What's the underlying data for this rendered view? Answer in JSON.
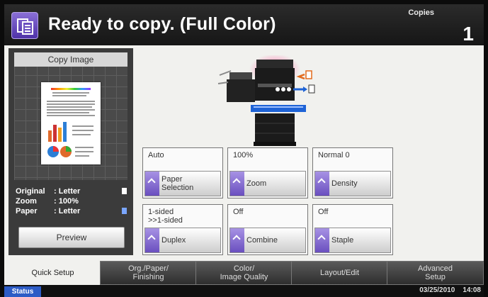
{
  "header": {
    "icon": "copy-icon",
    "title": "Ready to copy. (Full Color)",
    "copies_label": "Copies",
    "copies_value": "1"
  },
  "preview": {
    "title": "Copy Image",
    "original_label": "Original",
    "original_value": ": Letter",
    "zoom_label": "Zoom",
    "zoom_value": ": 100%",
    "paper_label": "Paper",
    "paper_value": ": Letter",
    "preview_button": "Preview"
  },
  "functions": [
    {
      "value": "Auto",
      "label": "Paper\nSelection",
      "icon": "chevron-up-icon"
    },
    {
      "value": "100%",
      "label": "Zoom",
      "icon": "chevron-up-icon"
    },
    {
      "value": "Normal 0",
      "label": "Density",
      "icon": "chevron-up-icon"
    },
    {
      "value": "1-sided\n>>1-sided",
      "label": "Duplex",
      "icon": "chevron-up-icon"
    },
    {
      "value": "Off",
      "label": "Combine",
      "icon": "chevron-up-icon"
    },
    {
      "value": "Off",
      "label": "Staple",
      "icon": "chevron-up-icon"
    }
  ],
  "tabs": [
    {
      "label": "Quick Setup",
      "active": true
    },
    {
      "label": "Org./Paper/\nFinishing",
      "active": false
    },
    {
      "label": "Color/\nImage Quality",
      "active": false
    },
    {
      "label": "Layout/Edit",
      "active": false
    },
    {
      "label": "Advanced\nSetup",
      "active": false
    }
  ],
  "status": {
    "button": "Status",
    "date": "03/25/2010",
    "time": "14:08"
  },
  "colors": {
    "accent_purple": "#6a4fbf",
    "status_blue": "#2d5cc6"
  }
}
